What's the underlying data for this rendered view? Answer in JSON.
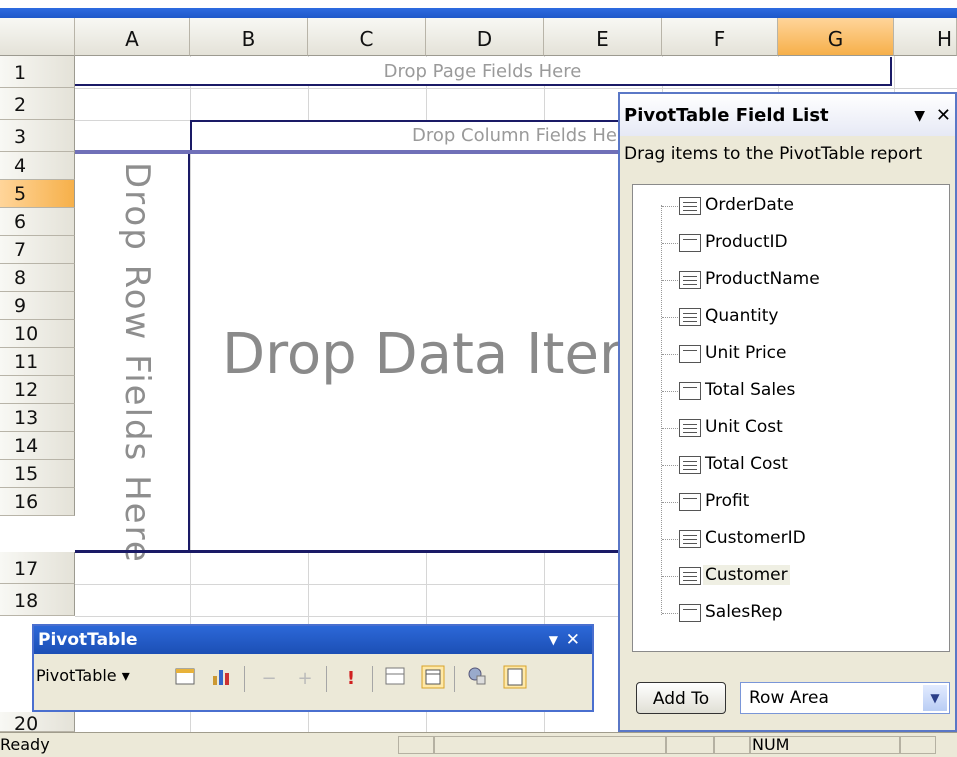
{
  "columns": [
    "A",
    "B",
    "C",
    "D",
    "E",
    "F",
    "G",
    "H"
  ],
  "selected_column": "G",
  "rows": [
    "1",
    "2",
    "3",
    "4",
    "5",
    "6",
    "7",
    "8",
    "9",
    "10",
    "11",
    "12",
    "13",
    "14",
    "15",
    "16",
    "17",
    "18"
  ],
  "partial_row": "20",
  "selected_row": "5",
  "pivot": {
    "page_fields": "Drop Page Fields Here",
    "column_fields": "Drop Column Fields Here",
    "row_fields": "Drop Row Fields Here",
    "data_items": "Drop Data Items Here"
  },
  "field_list": {
    "title": "PivotTable Field List",
    "hint": "Drag items to the PivotTable report",
    "fields": [
      "OrderDate",
      "ProductID",
      "ProductName",
      "Quantity",
      "Unit Price",
      "Total Sales",
      "Unit Cost",
      "Total Cost",
      "Profit",
      "CustomerID",
      "Customer",
      "SalesRep"
    ],
    "add_to_label": "Add To",
    "area_value": "Row Area"
  },
  "pivot_toolbar": {
    "title": "PivotTable",
    "menu_label": "PivotTable ▾"
  },
  "status": {
    "ready": "Ready",
    "num": "NUM"
  },
  "colors": {
    "titlebar": "#2c68d8",
    "pivot_border": "#1a1a66",
    "selection": "#f6b04a"
  }
}
